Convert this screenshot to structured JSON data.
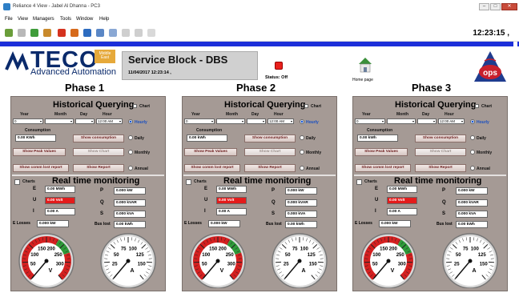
{
  "window": {
    "title": "Reliance 4 View - Jabel Al Dhanna - PC3",
    "min": "–",
    "max": "□",
    "close": "✕"
  },
  "menu": [
    "File",
    "View",
    "Managers",
    "Tools",
    "Window",
    "Help"
  ],
  "toolbar": {
    "clock": "12:23:15 ,"
  },
  "header": {
    "logo_text": "TECO",
    "logo_sub": "Advanced Automation",
    "logo_badge": "Middle East",
    "title": "Service Block - DBS",
    "date": "11/04/2017 12:23:14 ,",
    "status_label": "Status: Off",
    "home_label": "Home page",
    "ops_logo": "ops"
  },
  "colors": {
    "status_off": "#e8201c",
    "blue_bar": "#1c2fd9",
    "panel": "#a59a95",
    "alarm_field": "#e31b1b"
  },
  "phases": [
    {
      "title": "Phase 1",
      "hq_title": "Historical Querying",
      "chart_label": "Chart",
      "year_lbl": "Year",
      "month_lbl": "Month",
      "day_lbl": "Day",
      "hour_lbl": "Hour",
      "year": "0",
      "month": "",
      "day": "",
      "hour": "12:00 AM",
      "hourly": "Hourly",
      "daily": "Daily",
      "monthly": "Monthly",
      "annual": "Annual",
      "consumption_lbl": "Consumption",
      "consumption": "0.00 KWh",
      "show_consumption": "Show consumption",
      "show_peak": "Show Peak Values",
      "show_chart": "Show Chart",
      "show_comm": "Show comm lost report",
      "show_report": "Show Report",
      "rt_title": "Real time monitoring",
      "charts_lbl": "Charts",
      "E": "0.00 MWh",
      "U": "0.00 Volt",
      "I": "0.00 A",
      "E_losses": "0.000 kW",
      "P": "0.000 kW",
      "Q": "0.000 kVAR",
      "S": "0.000 kVA",
      "bus_lost": "0.00 kWh",
      "g1_unit": "V",
      "g2_unit": "A"
    },
    {
      "title": "Phase 2",
      "hq_title": "Historical Querying",
      "chart_label": "Chart",
      "year_lbl": "Year",
      "month_lbl": "Month",
      "day_lbl": "Day",
      "hour_lbl": "Hour",
      "year": "0",
      "month": "",
      "day": "",
      "hour": "12:00 AM",
      "hourly": "Hourly",
      "daily": "Daily",
      "monthly": "Monthly",
      "annual": "Annual",
      "consumption_lbl": "Consumption",
      "consumption": "0.00 kWh",
      "show_consumption": "Show consumption",
      "show_peak": "Show Peak Values",
      "show_chart": "Show Chart",
      "show_comm": "Show comm lost report",
      "show_report": "Show Report",
      "rt_title": "Real time monitoring",
      "charts_lbl": "Charts",
      "E": "0.00 MWh",
      "U": "0.00 Volt",
      "I": "0.00 A",
      "E_losses": "0.000 kW",
      "P": "0.000 kW",
      "Q": "0.000 kVAR",
      "S": "0.000 kVA",
      "bus_lost": "0.00 kWh",
      "g1_unit": "V",
      "g2_unit": "A"
    },
    {
      "title": "Phase 3",
      "hq_title": "Historical Querying",
      "chart_label": "Chart",
      "year_lbl": "Year",
      "month_lbl": "Month",
      "day_lbl": "Day",
      "hour_lbl": "Hour",
      "year": "0",
      "month": "",
      "day": "",
      "hour": "12:00 AM",
      "hourly": "Hourly",
      "daily": "Daily",
      "monthly": "Monthly",
      "annual": "Annual",
      "consumption_lbl": "Consumption",
      "consumption": "0.00 kWh",
      "show_consumption": "Show consumption",
      "show_peak": "Show Peak Values",
      "show_chart": "Show Chart",
      "show_comm": "Show comm lost report",
      "show_report": "Show Report",
      "rt_title": "Real time monitoring",
      "charts_lbl": "Charts",
      "E": "0.00 MWh",
      "U": "0.00 Volt",
      "I": "0.00 A",
      "E_losses": "0.000 kW",
      "P": "0.000 kW",
      "Q": "0.000 kVAR",
      "S": "0.000 kVA",
      "bus_lost": "0.00 kWh",
      "g1_unit": "V",
      "g2_unit": "A"
    }
  ],
  "gauges": {
    "voltage_ticks": [
      "50",
      "100",
      "150",
      "200",
      "250",
      "300"
    ],
    "current_ticks": [
      "25",
      "50",
      "75",
      "100",
      "125",
      "150"
    ]
  },
  "labels": {
    "E": "E",
    "U": "U",
    "I": "I",
    "E_losses": "E Losses",
    "P": "P",
    "Q": "Q",
    "S": "S",
    "bus_lost": "Bus lost"
  }
}
